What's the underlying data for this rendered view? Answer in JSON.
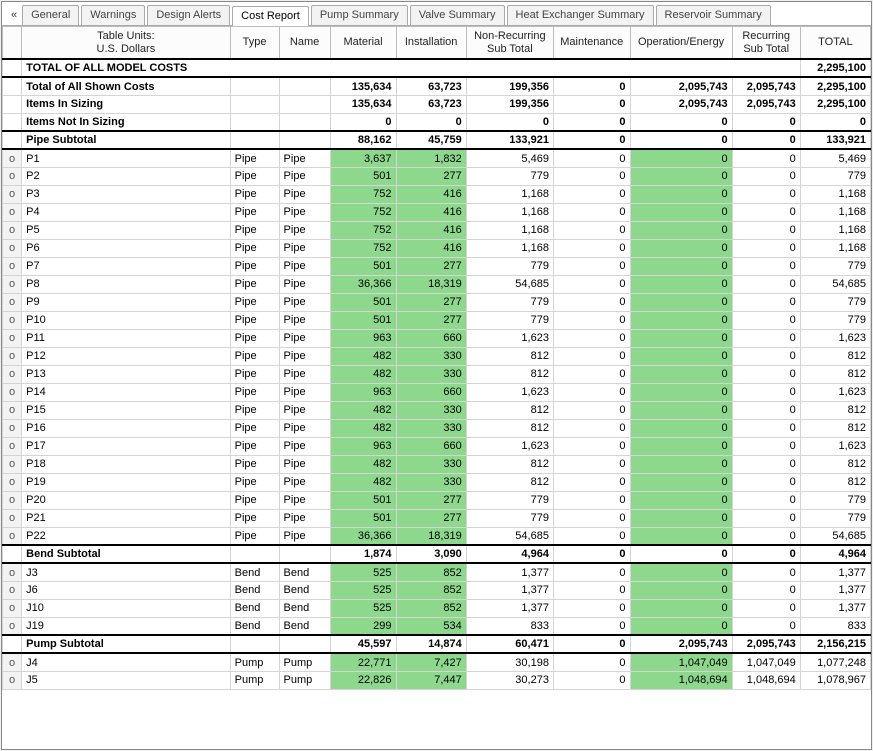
{
  "tabs": {
    "chevron": "«",
    "items": [
      "General",
      "Warnings",
      "Design Alerts",
      "Cost Report",
      "Pump Summary",
      "Valve Summary",
      "Heat Exchanger Summary",
      "Reservoir Summary"
    ],
    "active": 3
  },
  "header": {
    "units": "Table Units:\nU.S. Dollars",
    "type": "Type",
    "name": "Name",
    "material": "Material",
    "installation": "Installation",
    "nrst": "Non-Recurring\nSub Total",
    "maint": "Maintenance",
    "ope": "Operation/Energy",
    "rst": "Recurring\nSub Total",
    "total": "TOTAL"
  },
  "grand": {
    "label": "TOTAL OF ALL MODEL COSTS",
    "total": "2,295,100"
  },
  "summary": [
    {
      "label": "Total of All Shown Costs",
      "mat": "135,634",
      "inst": "63,723",
      "nrst": "199,356",
      "maint": "0",
      "ope": "2,095,743",
      "rst": "2,095,743",
      "tot": "2,295,100"
    },
    {
      "label": "Items In Sizing",
      "mat": "135,634",
      "inst": "63,723",
      "nrst": "199,356",
      "maint": "0",
      "ope": "2,095,743",
      "rst": "2,095,743",
      "tot": "2,295,100"
    },
    {
      "label": "Items Not In Sizing",
      "mat": "0",
      "inst": "0",
      "nrst": "0",
      "maint": "0",
      "ope": "0",
      "rst": "0",
      "tot": "0"
    }
  ],
  "sections": [
    {
      "label": "Pipe Subtotal",
      "mat": "88,162",
      "inst": "45,759",
      "nrst": "133,921",
      "maint": "0",
      "ope": "0",
      "rst": "0",
      "tot": "133,921",
      "rows": [
        {
          "id": "P1",
          "type": "Pipe",
          "name": "Pipe",
          "mat": "3,637",
          "inst": "1,832",
          "nrst": "5,469",
          "maint": "0",
          "ope": "0",
          "rst": "0",
          "tot": "5,469"
        },
        {
          "id": "P2",
          "type": "Pipe",
          "name": "Pipe",
          "mat": "501",
          "inst": "277",
          "nrst": "779",
          "maint": "0",
          "ope": "0",
          "rst": "0",
          "tot": "779"
        },
        {
          "id": "P3",
          "type": "Pipe",
          "name": "Pipe",
          "mat": "752",
          "inst": "416",
          "nrst": "1,168",
          "maint": "0",
          "ope": "0",
          "rst": "0",
          "tot": "1,168"
        },
        {
          "id": "P4",
          "type": "Pipe",
          "name": "Pipe",
          "mat": "752",
          "inst": "416",
          "nrst": "1,168",
          "maint": "0",
          "ope": "0",
          "rst": "0",
          "tot": "1,168"
        },
        {
          "id": "P5",
          "type": "Pipe",
          "name": "Pipe",
          "mat": "752",
          "inst": "416",
          "nrst": "1,168",
          "maint": "0",
          "ope": "0",
          "rst": "0",
          "tot": "1,168"
        },
        {
          "id": "P6",
          "type": "Pipe",
          "name": "Pipe",
          "mat": "752",
          "inst": "416",
          "nrst": "1,168",
          "maint": "0",
          "ope": "0",
          "rst": "0",
          "tot": "1,168"
        },
        {
          "id": "P7",
          "type": "Pipe",
          "name": "Pipe",
          "mat": "501",
          "inst": "277",
          "nrst": "779",
          "maint": "0",
          "ope": "0",
          "rst": "0",
          "tot": "779"
        },
        {
          "id": "P8",
          "type": "Pipe",
          "name": "Pipe",
          "mat": "36,366",
          "inst": "18,319",
          "nrst": "54,685",
          "maint": "0",
          "ope": "0",
          "rst": "0",
          "tot": "54,685"
        },
        {
          "id": "P9",
          "type": "Pipe",
          "name": "Pipe",
          "mat": "501",
          "inst": "277",
          "nrst": "779",
          "maint": "0",
          "ope": "0",
          "rst": "0",
          "tot": "779"
        },
        {
          "id": "P10",
          "type": "Pipe",
          "name": "Pipe",
          "mat": "501",
          "inst": "277",
          "nrst": "779",
          "maint": "0",
          "ope": "0",
          "rst": "0",
          "tot": "779"
        },
        {
          "id": "P11",
          "type": "Pipe",
          "name": "Pipe",
          "mat": "963",
          "inst": "660",
          "nrst": "1,623",
          "maint": "0",
          "ope": "0",
          "rst": "0",
          "tot": "1,623"
        },
        {
          "id": "P12",
          "type": "Pipe",
          "name": "Pipe",
          "mat": "482",
          "inst": "330",
          "nrst": "812",
          "maint": "0",
          "ope": "0",
          "rst": "0",
          "tot": "812"
        },
        {
          "id": "P13",
          "type": "Pipe",
          "name": "Pipe",
          "mat": "482",
          "inst": "330",
          "nrst": "812",
          "maint": "0",
          "ope": "0",
          "rst": "0",
          "tot": "812"
        },
        {
          "id": "P14",
          "type": "Pipe",
          "name": "Pipe",
          "mat": "963",
          "inst": "660",
          "nrst": "1,623",
          "maint": "0",
          "ope": "0",
          "rst": "0",
          "tot": "1,623"
        },
        {
          "id": "P15",
          "type": "Pipe",
          "name": "Pipe",
          "mat": "482",
          "inst": "330",
          "nrst": "812",
          "maint": "0",
          "ope": "0",
          "rst": "0",
          "tot": "812"
        },
        {
          "id": "P16",
          "type": "Pipe",
          "name": "Pipe",
          "mat": "482",
          "inst": "330",
          "nrst": "812",
          "maint": "0",
          "ope": "0",
          "rst": "0",
          "tot": "812"
        },
        {
          "id": "P17",
          "type": "Pipe",
          "name": "Pipe",
          "mat": "963",
          "inst": "660",
          "nrst": "1,623",
          "maint": "0",
          "ope": "0",
          "rst": "0",
          "tot": "1,623"
        },
        {
          "id": "P18",
          "type": "Pipe",
          "name": "Pipe",
          "mat": "482",
          "inst": "330",
          "nrst": "812",
          "maint": "0",
          "ope": "0",
          "rst": "0",
          "tot": "812"
        },
        {
          "id": "P19",
          "type": "Pipe",
          "name": "Pipe",
          "mat": "482",
          "inst": "330",
          "nrst": "812",
          "maint": "0",
          "ope": "0",
          "rst": "0",
          "tot": "812"
        },
        {
          "id": "P20",
          "type": "Pipe",
          "name": "Pipe",
          "mat": "501",
          "inst": "277",
          "nrst": "779",
          "maint": "0",
          "ope": "0",
          "rst": "0",
          "tot": "779"
        },
        {
          "id": "P21",
          "type": "Pipe",
          "name": "Pipe",
          "mat": "501",
          "inst": "277",
          "nrst": "779",
          "maint": "0",
          "ope": "0",
          "rst": "0",
          "tot": "779"
        },
        {
          "id": "P22",
          "type": "Pipe",
          "name": "Pipe",
          "mat": "36,366",
          "inst": "18,319",
          "nrst": "54,685",
          "maint": "0",
          "ope": "0",
          "rst": "0",
          "tot": "54,685"
        }
      ]
    },
    {
      "label": "Bend Subtotal",
      "mat": "1,874",
      "inst": "3,090",
      "nrst": "4,964",
      "maint": "0",
      "ope": "0",
      "rst": "0",
      "tot": "4,964",
      "rows": [
        {
          "id": "J3",
          "type": "Bend",
          "name": "Bend",
          "mat": "525",
          "inst": "852",
          "nrst": "1,377",
          "maint": "0",
          "ope": "0",
          "rst": "0",
          "tot": "1,377"
        },
        {
          "id": "J6",
          "type": "Bend",
          "name": "Bend",
          "mat": "525",
          "inst": "852",
          "nrst": "1,377",
          "maint": "0",
          "ope": "0",
          "rst": "0",
          "tot": "1,377"
        },
        {
          "id": "J10",
          "type": "Bend",
          "name": "Bend",
          "mat": "525",
          "inst": "852",
          "nrst": "1,377",
          "maint": "0",
          "ope": "0",
          "rst": "0",
          "tot": "1,377"
        },
        {
          "id": "J19",
          "type": "Bend",
          "name": "Bend",
          "mat": "299",
          "inst": "534",
          "nrst": "833",
          "maint": "0",
          "ope": "0",
          "rst": "0",
          "tot": "833"
        }
      ]
    },
    {
      "label": "Pump Subtotal",
      "mat": "45,597",
      "inst": "14,874",
      "nrst": "60,471",
      "maint": "0",
      "ope": "2,095,743",
      "rst": "2,095,743",
      "tot": "2,156,215",
      "rows": [
        {
          "id": "J4",
          "type": "Pump",
          "name": "Pump",
          "mat": "22,771",
          "inst": "7,427",
          "nrst": "30,198",
          "maint": "0",
          "ope": "1,047,049",
          "rst": "1,047,049",
          "tot": "1,077,248"
        },
        {
          "id": "J5",
          "type": "Pump",
          "name": "Pump",
          "mat": "22,826",
          "inst": "7,447",
          "nrst": "30,273",
          "maint": "0",
          "ope": "1,048,694",
          "rst": "1,048,694",
          "tot": "1,078,967"
        }
      ]
    }
  ]
}
